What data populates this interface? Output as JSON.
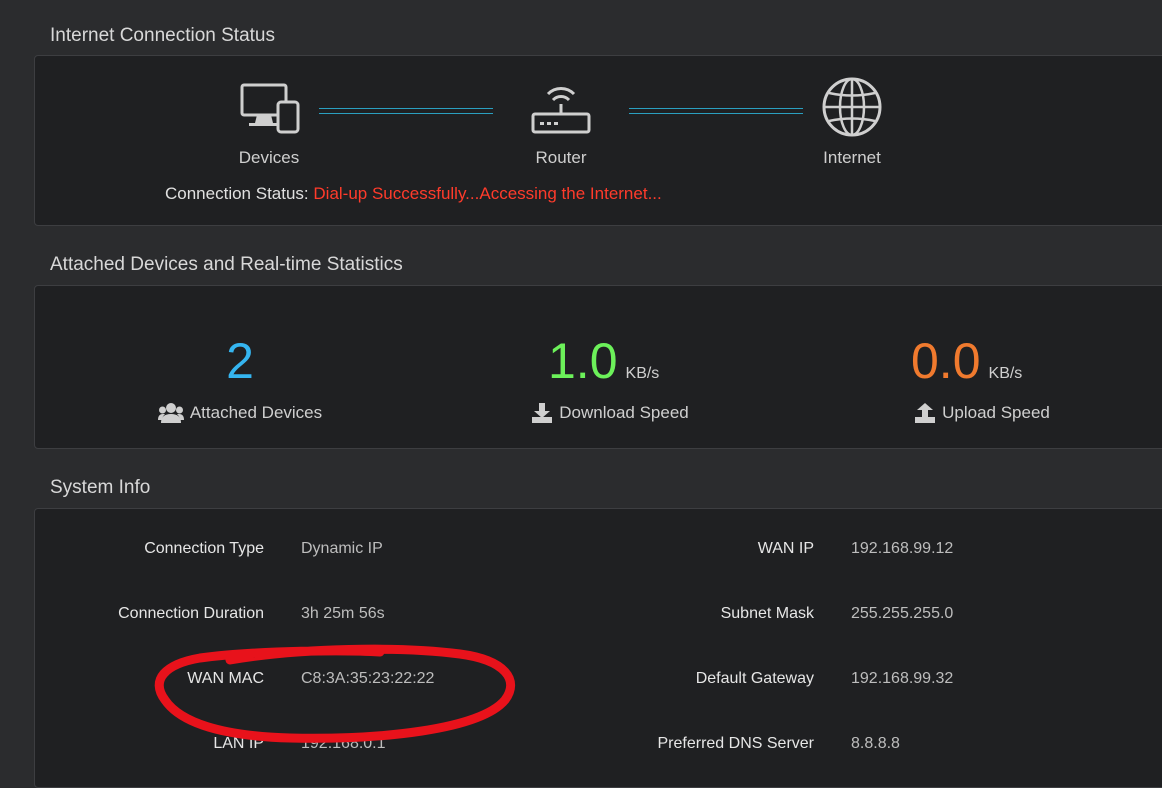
{
  "internet_status": {
    "title": "Internet Connection Status",
    "nodes": {
      "devices": "Devices",
      "router": "Router",
      "internet": "Internet"
    },
    "connection_status_label": "Connection Status:",
    "connection_status_value": "Dial-up Successfully...Accessing the Internet..."
  },
  "stats": {
    "title": "Attached Devices and Real-time Statistics",
    "attached": {
      "value": "2",
      "caption": "Attached Devices",
      "icon": "users-icon",
      "color": "#35b5f0"
    },
    "download": {
      "value": "1.0",
      "unit": "KB/s",
      "caption": "Download Speed",
      "icon": "download-icon",
      "color": "#6cf15a"
    },
    "upload": {
      "value": "0.0",
      "unit": "KB/s",
      "caption": "Upload Speed",
      "icon": "upload-icon",
      "color": "#f07a2e"
    }
  },
  "system_info": {
    "title": "System Info",
    "left": [
      {
        "key": "Connection Type",
        "value": "Dynamic IP"
      },
      {
        "key": "Connection Duration",
        "value": "3h 25m 56s"
      },
      {
        "key": "WAN MAC",
        "value": "C8:3A:35:23:22:22"
      },
      {
        "key": "LAN IP",
        "value": "192.168.0.1"
      }
    ],
    "right": [
      {
        "key": "WAN IP",
        "value": "192.168.99.12"
      },
      {
        "key": "Subnet Mask",
        "value": "255.255.255.0"
      },
      {
        "key": "Default Gateway",
        "value": "192.168.99.32"
      },
      {
        "key": "Preferred DNS Server",
        "value": "8.8.8.8"
      }
    ]
  },
  "colors": {
    "background": "#2b2c2e",
    "panel": "#1f2022",
    "status_error": "#ff3b2b",
    "link_line": "#2a9fc0",
    "annotation": "#e8121b"
  }
}
